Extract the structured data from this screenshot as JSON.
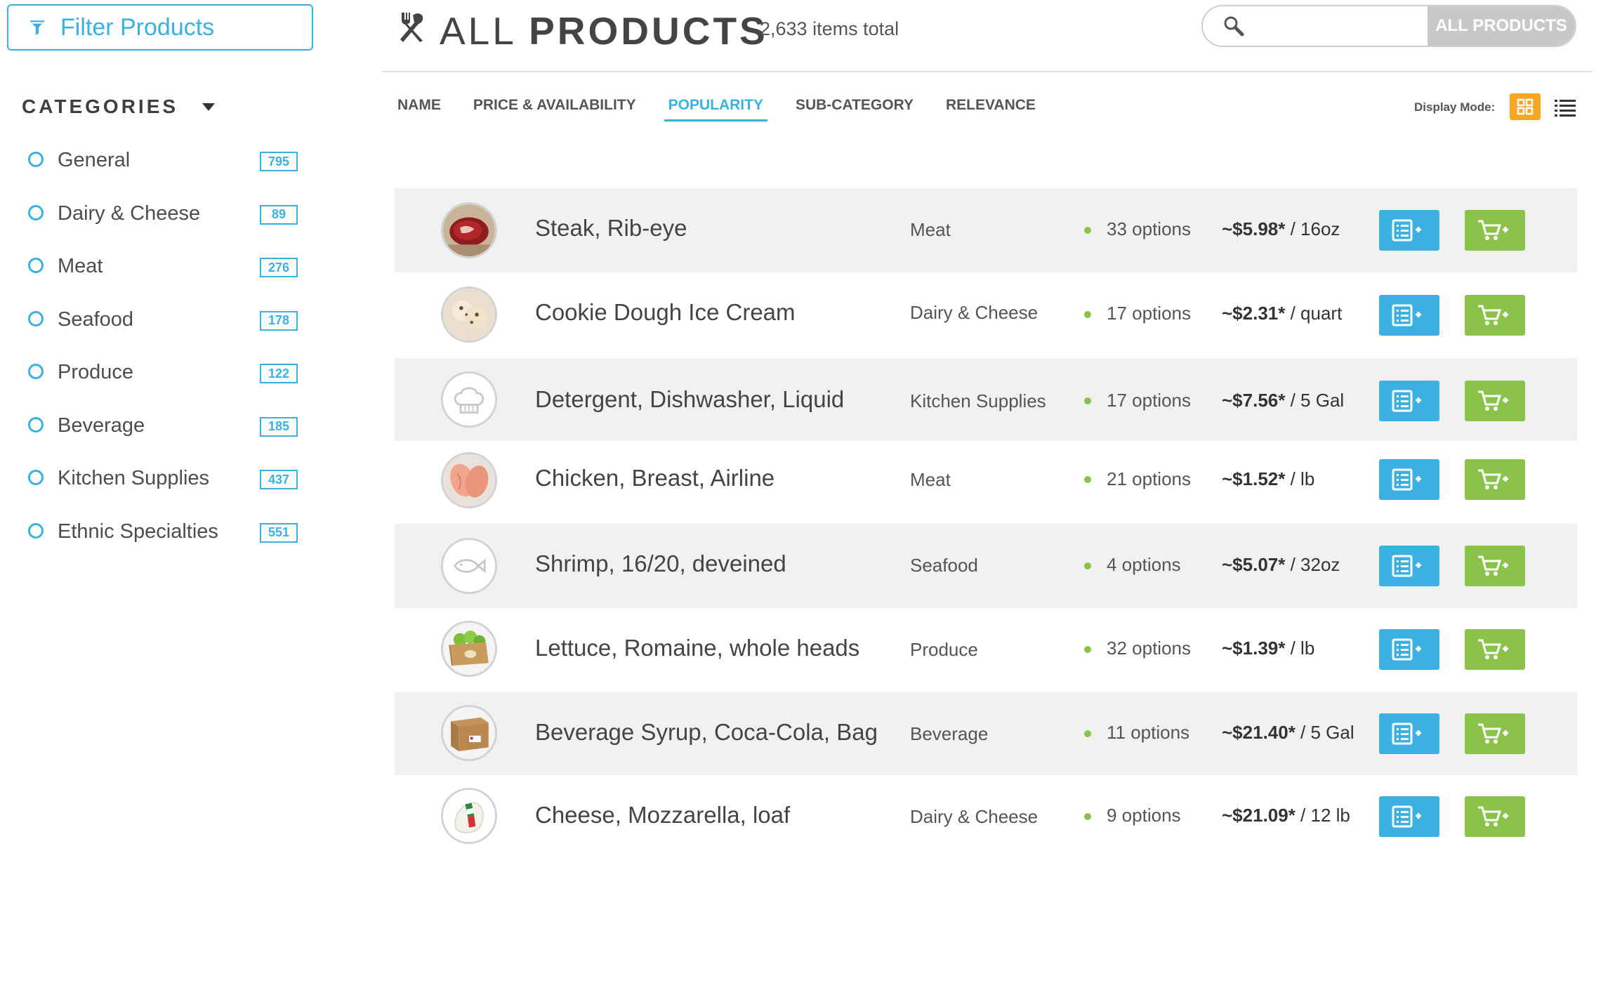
{
  "sidebar": {
    "filter_label": "Filter Products",
    "categories_title": "CATEGORIES",
    "categories": [
      {
        "label": "General",
        "count": "795"
      },
      {
        "label": "Dairy & Cheese",
        "count": "89"
      },
      {
        "label": "Meat",
        "count": "276"
      },
      {
        "label": "Seafood",
        "count": "178"
      },
      {
        "label": "Produce",
        "count": "122"
      },
      {
        "label": "Beverage",
        "count": "185"
      },
      {
        "label": "Kitchen Supplies",
        "count": "437"
      },
      {
        "label": "Ethnic Specialties",
        "count": "551"
      }
    ]
  },
  "header": {
    "title_light": "ALL ",
    "title_bold": "PRODUCTS",
    "items_total": "2,633 items total",
    "search_placeholder": "",
    "search_scope": "ALL PRODUCTS"
  },
  "sort_tabs": [
    "NAME",
    "PRICE & AVAILABILITY",
    "POPULARITY",
    "SUB-CATEGORY",
    "RELEVANCE"
  ],
  "active_sort": "POPULARITY",
  "display_mode": {
    "label": "Display Mode:",
    "active": "grid"
  },
  "colors": {
    "accent_blue": "#3bb1e2",
    "accent_green": "#8bc34a",
    "accent_orange": "#f5a623",
    "row_shade": "#f1f1f1"
  },
  "products": [
    {
      "name": "Steak, Rib-eye",
      "category": "Meat",
      "options": "33 options",
      "price": "~$5.98*",
      "unit": " / 16oz",
      "image": "steak-photo"
    },
    {
      "name": "Cookie Dough Ice Cream",
      "category": "Dairy & Cheese",
      "options": "17 options",
      "price": "~$2.31*",
      "unit": " / quart",
      "image": "ice-cream-photo"
    },
    {
      "name": "Detergent, Dishwasher, Liquid",
      "category": "Kitchen Supplies",
      "options": "17 options",
      "price": "~$7.56*",
      "unit": " / 5 Gal",
      "image": "chef-hat-icon"
    },
    {
      "name": "Chicken, Breast, Airline",
      "category": "Meat",
      "options": "21 options",
      "price": "~$1.52*",
      "unit": " / lb",
      "image": "chicken-photo"
    },
    {
      "name": "Shrimp, 16/20, deveined",
      "category": "Seafood",
      "options": "4 options",
      "price": "~$5.07*",
      "unit": " / 32oz",
      "image": "fish-icon"
    },
    {
      "name": "Lettuce, Romaine, whole heads",
      "category": "Produce",
      "options": "32 options",
      "price": "~$1.39*",
      "unit": " / lb",
      "image": "lettuce-box-photo"
    },
    {
      "name": "Beverage Syrup, Coca-Cola, Bag",
      "category": "Beverage",
      "options": "11 options",
      "price": "~$21.40*",
      "unit": " / 5 Gal",
      "image": "syrup-box-photo"
    },
    {
      "name": "Cheese, Mozzarella, loaf",
      "category": "Dairy & Cheese",
      "options": "9 options",
      "price": "~$21.09*",
      "unit": " / 12 lb",
      "image": "mozzarella-photo"
    }
  ]
}
